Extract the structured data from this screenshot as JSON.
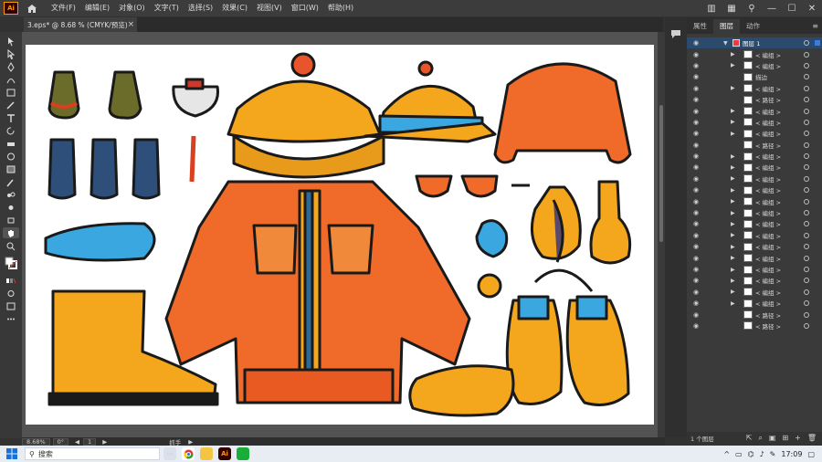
{
  "app": {
    "logo": "Ai",
    "menu": [
      "文件(F)",
      "编辑(E)",
      "对象(O)",
      "文字(T)",
      "选择(S)",
      "效果(C)",
      "视图(V)",
      "窗口(W)",
      "帮助(H)"
    ]
  },
  "document_tab": {
    "title": "3.eps* @ 8.68 % (CMYK/预览)",
    "close": "×"
  },
  "status": {
    "zoom": "8.68%",
    "rotation": "0°",
    "artboard": "1",
    "tool": "抓手"
  },
  "panel": {
    "tabs": [
      "属性",
      "图层",
      "动作"
    ],
    "active_tab": "图层",
    "layer_name": "图层 1",
    "rows": [
      "< 编组 >",
      "< 编组 >",
      "描边",
      "< 编组 >",
      "< 路径 >",
      "< 编组 >",
      "< 编组 >",
      "< 编组 >",
      "< 路径 >",
      "< 编组 >",
      "< 编组 >",
      "< 编组 >",
      "< 编组 >",
      "< 编组 >",
      "< 编组 >",
      "< 编组 >",
      "< 编组 >",
      "< 编组 >",
      "< 编组 >",
      "< 编组 >",
      "< 编组 >",
      "< 编组 >",
      "< 编组 >",
      "< 路径 >",
      "< 路径 >"
    ],
    "rows_with_arrow": [
      true,
      true,
      false,
      true,
      false,
      true,
      true,
      true,
      false,
      true,
      true,
      true,
      true,
      true,
      true,
      true,
      true,
      true,
      true,
      true,
      true,
      true,
      true,
      false,
      false
    ],
    "footer": "1 个图层"
  },
  "taskbar": {
    "search_placeholder": "搜索",
    "clock": "17:09"
  },
  "icons": {
    "home": "home-icon",
    "comment": "comment-icon"
  }
}
